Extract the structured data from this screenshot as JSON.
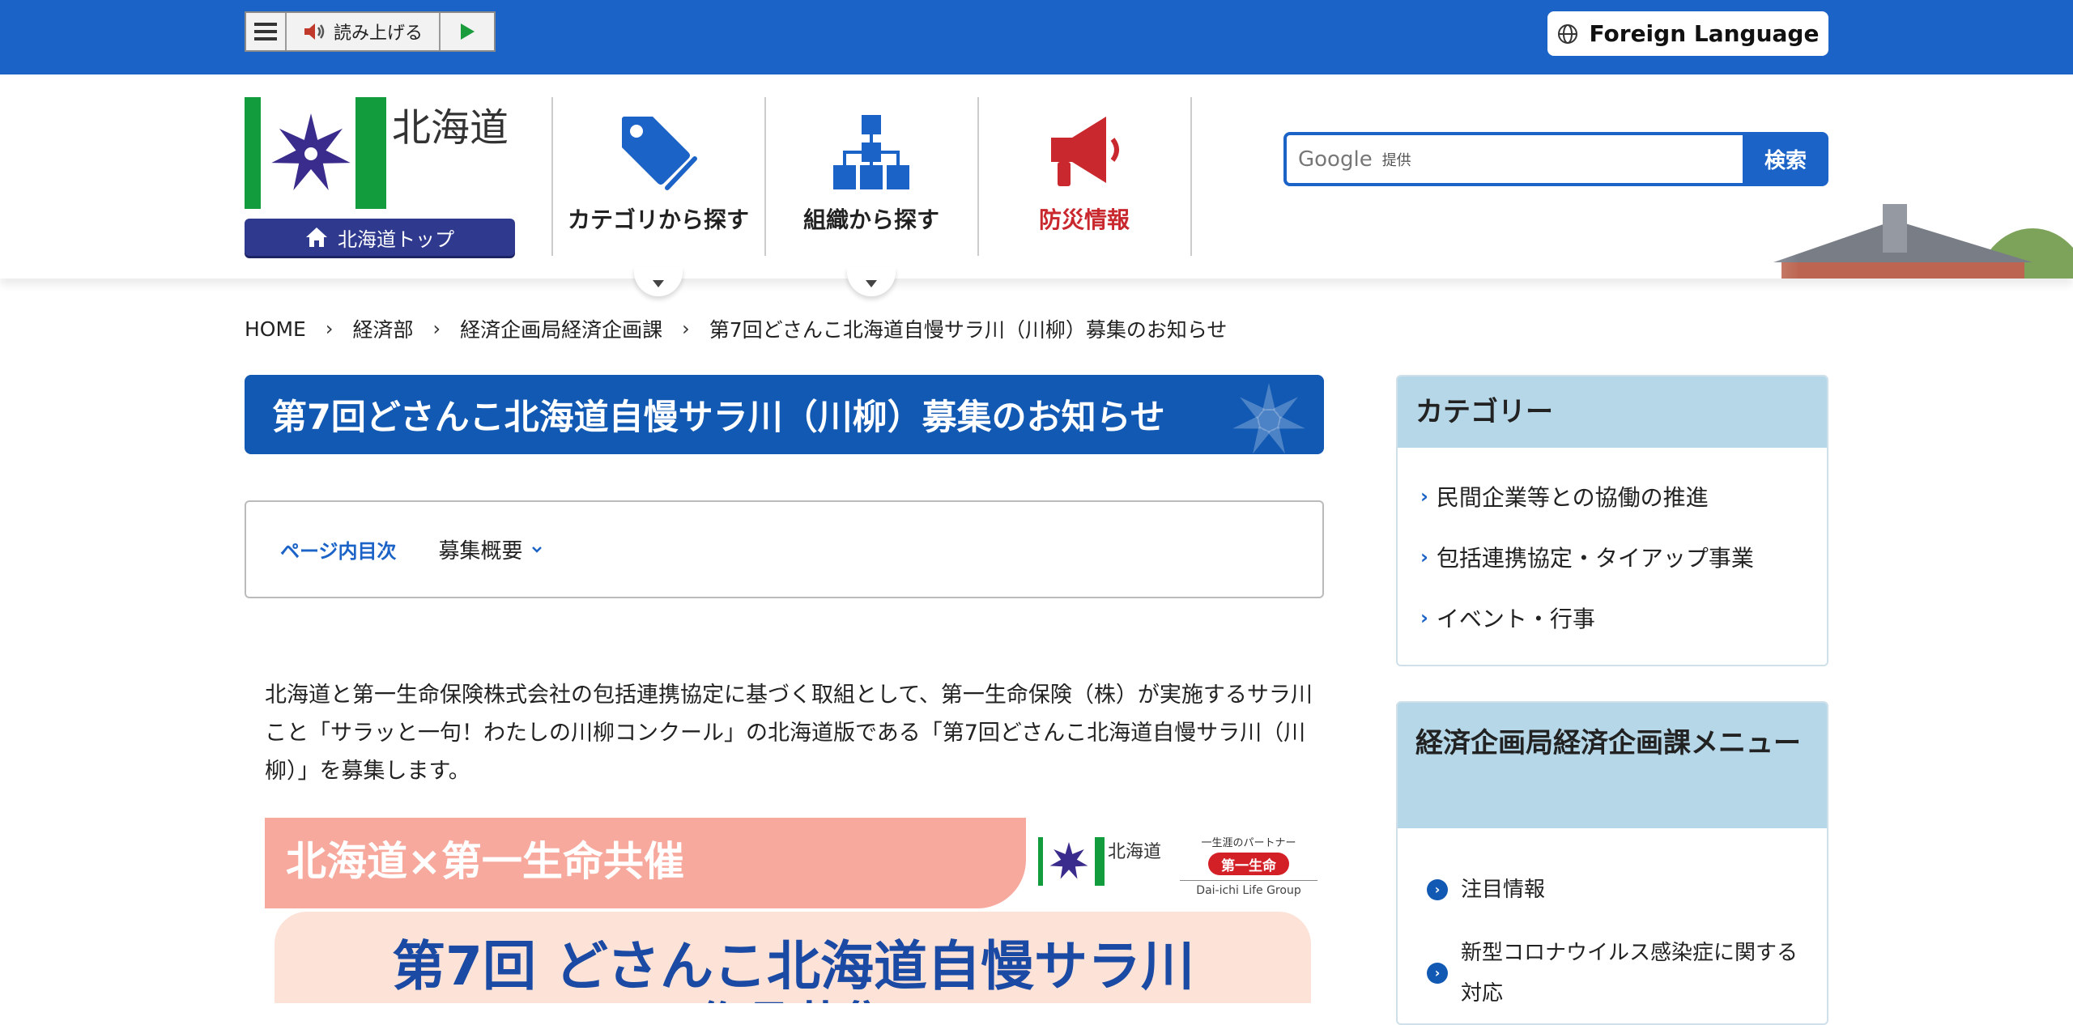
{
  "reader": {
    "read_label": "読み上げる"
  },
  "foreign": {
    "label": "Foreign Language"
  },
  "logo": {
    "name": "北海道"
  },
  "top_button": {
    "label": "北海道トップ"
  },
  "nav": [
    {
      "label": "カテゴリから探す"
    },
    {
      "label": "組織から探す"
    },
    {
      "label": "防災情報"
    }
  ],
  "search": {
    "brand": "Google",
    "placeholder": "提供",
    "button": "検索"
  },
  "breadcrumb": [
    "HOME",
    "経済部",
    "経済企画局経済企画課",
    "第7回どさんこ北海道自慢サラ川（川柳）募集のお知らせ"
  ],
  "page_title": "第7回どさんこ北海道自慢サラ川（川柳）募集のお知らせ",
  "toc": {
    "heading": "ページ内目次",
    "item": "募集概要"
  },
  "body_text": "北海道と第一生命保険株式会社の包括連携協定に基づく取組として、第一生命保険（株）が実施するサラ川こと「サラッと一句！わたしの川柳コンクール」の北海道版である「第7回どさんこ北海道自慢サラ川（川柳）」を募集します。",
  "banner": {
    "header": "北海道×第一生命共催",
    "logo_text": "北海道",
    "partner_tag": "一生涯のパートナー",
    "partner_name": "第一生命",
    "partner_group": "Dai-ichi Life Group",
    "main_line1": "第7回 どさんこ北海道自慢サラ川",
    "main_line2": "作品募集"
  },
  "sidebar_category": {
    "title": "カテゴリー",
    "items": [
      "民間企業等との協働の推進",
      "包括連携協定・タイアップ事業",
      "イベント・行事"
    ]
  },
  "sidebar_menu": {
    "title": "経済企画局経済企画課メニュー",
    "items": [
      "注目情報",
      "新型コロナウイルス感染症に関する対応"
    ]
  },
  "colors": {
    "brand_blue": "#1b63c7",
    "title_blue": "#1159b3",
    "disaster_red": "#c8282e",
    "side_header": "#b6d7e8"
  }
}
